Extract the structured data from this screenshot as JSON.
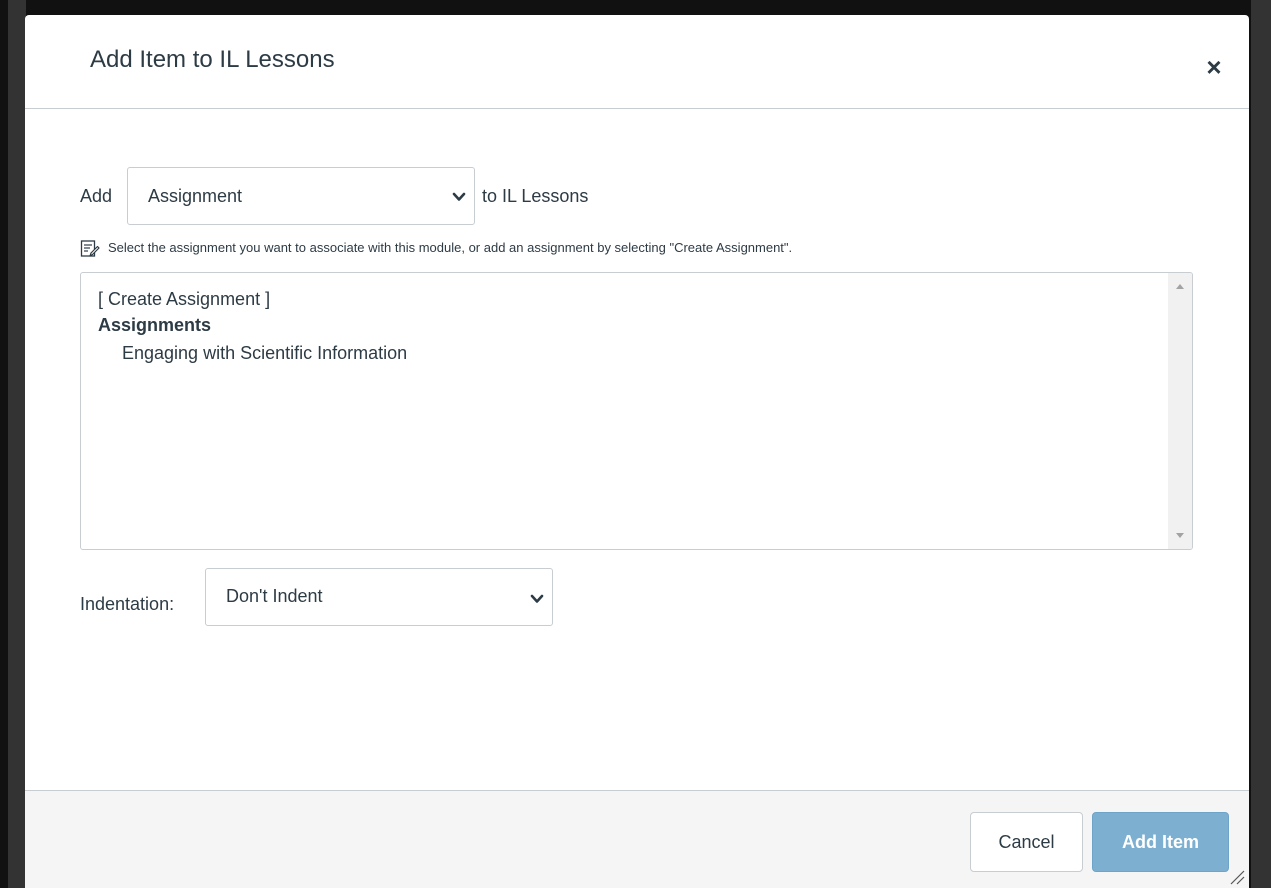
{
  "dialog": {
    "title": "Add Item to IL Lessons",
    "close_glyph": "×"
  },
  "add_row": {
    "prefix_label": "Add",
    "item_type": {
      "selected": "Assignment",
      "icon": "chevron-down-icon"
    },
    "suffix_label": "to IL Lessons"
  },
  "hint": {
    "icon": "notepad-pencil-icon",
    "text": "Select the assignment you want to associate with this module, or add an assignment by selecting \"Create Assignment\"."
  },
  "assignment_list": {
    "create_option": "[ Create Assignment ]",
    "group_label": "Assignments",
    "items": [
      "Engaging with Scientific Information"
    ]
  },
  "indentation": {
    "label": "Indentation:",
    "selected": "Don't Indent",
    "icon": "chevron-down-icon"
  },
  "footer": {
    "cancel_label": "Cancel",
    "add_label": "Add Item"
  },
  "colors": {
    "text": "#2d3b45",
    "border": "#c7cdd1",
    "primary_disabled": "#7dafd0",
    "footer_bg": "#f5f5f5"
  }
}
